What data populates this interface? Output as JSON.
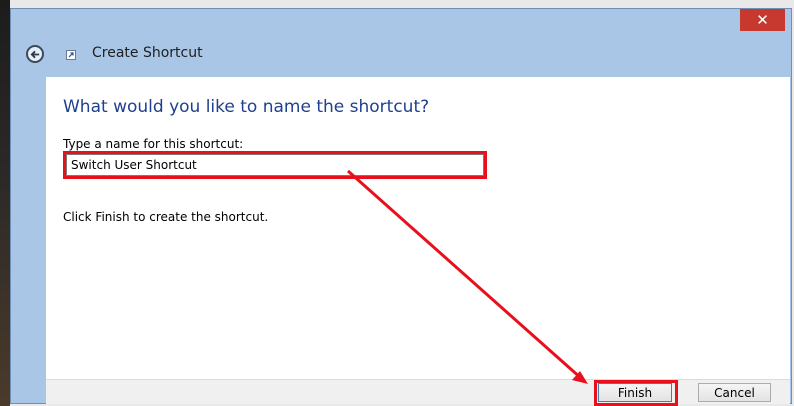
{
  "window": {
    "title": "Create Shortcut",
    "close_symbol": "✕"
  },
  "icons": {
    "back": "back-arrow-icon",
    "app": "shortcut-icon",
    "close": "close-icon"
  },
  "dialog": {
    "heading": "What would you like to name the shortcut?",
    "field_label": "Type a name for this shortcut:",
    "name_value": "Switch User Shortcut",
    "hint": "Click Finish to create the shortcut."
  },
  "buttons": {
    "finish": "Finish",
    "cancel": "Cancel"
  },
  "annotation": {
    "color": "#e8101c"
  },
  "colors": {
    "title_bar": "#aac6e6",
    "heading": "#1f3f8f",
    "close_button": "#c7392e"
  }
}
